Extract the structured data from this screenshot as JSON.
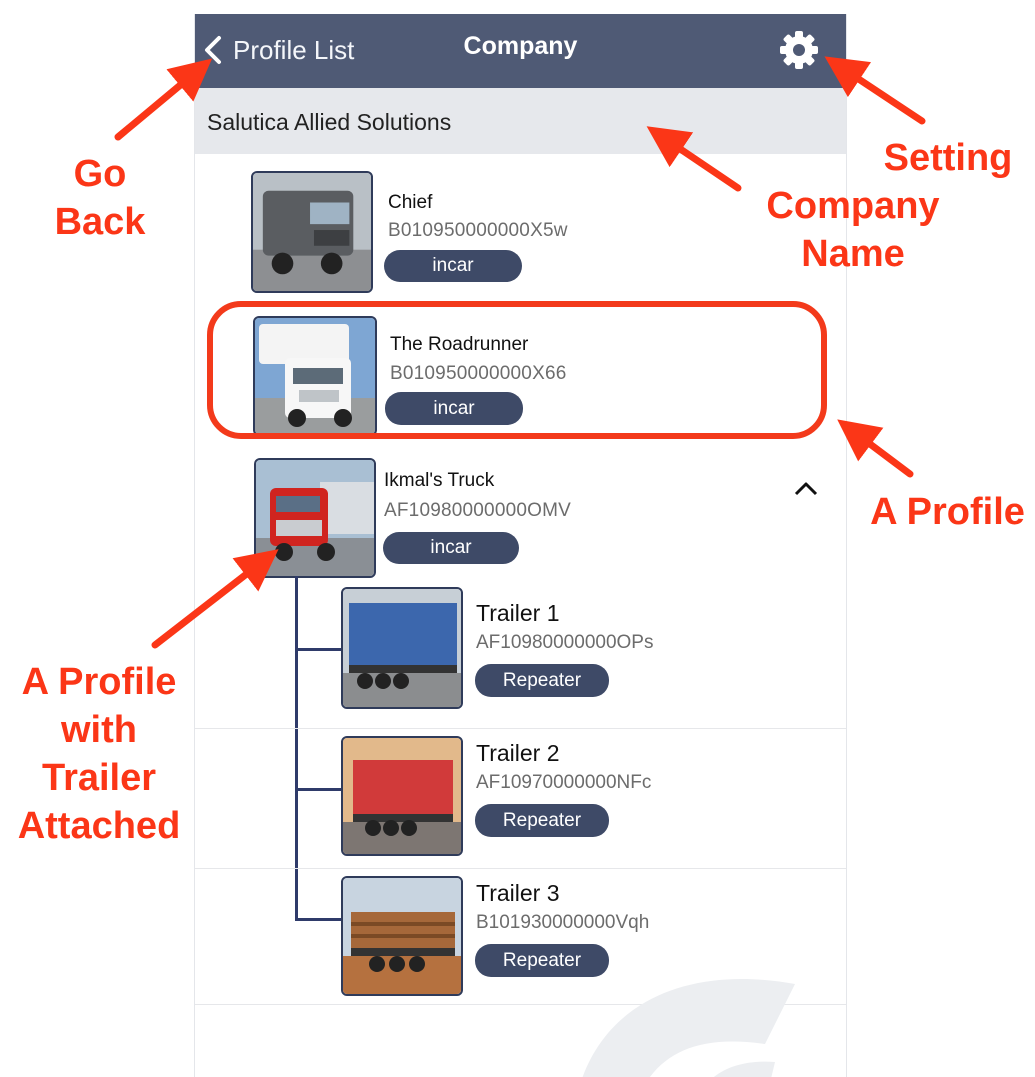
{
  "navbar": {
    "back_label": "Profile List",
    "title": "Company",
    "settings_icon": "gear-icon",
    "back_icon": "chevron-left-icon",
    "background": "#4f5a75"
  },
  "company": {
    "name": "Salutica Allied Solutions"
  },
  "profiles": [
    {
      "name": "Chief",
      "serial": "B010950000000X5w",
      "badge": "incar"
    },
    {
      "name": "The Roadrunner",
      "serial": "B010950000000X66",
      "badge": "incar"
    },
    {
      "name": "Ikmal's Truck",
      "serial": "AF10980000000OMV",
      "badge": "incar",
      "expand_icon": "chevron-up-icon"
    }
  ],
  "trailers": [
    {
      "name": "Trailer 1",
      "serial": "AF10980000000OPs",
      "badge": "Repeater"
    },
    {
      "name": "Trailer 2",
      "serial": "AF10970000000NFc",
      "badge": "Repeater"
    },
    {
      "name": "Trailer 3",
      "serial": "B101930000000Vqh",
      "badge": "Repeater"
    }
  ],
  "annotations": {
    "go_back_1": "Go",
    "go_back_2": "Back",
    "setting": "Setting",
    "company_name_1": "Company",
    "company_name_2": "Name",
    "a_profile": "A Profile",
    "trailer_1": "A Profile",
    "trailer_2": "with",
    "trailer_3": "Trailer",
    "trailer_4": "Attached",
    "color": "#fb3617"
  }
}
